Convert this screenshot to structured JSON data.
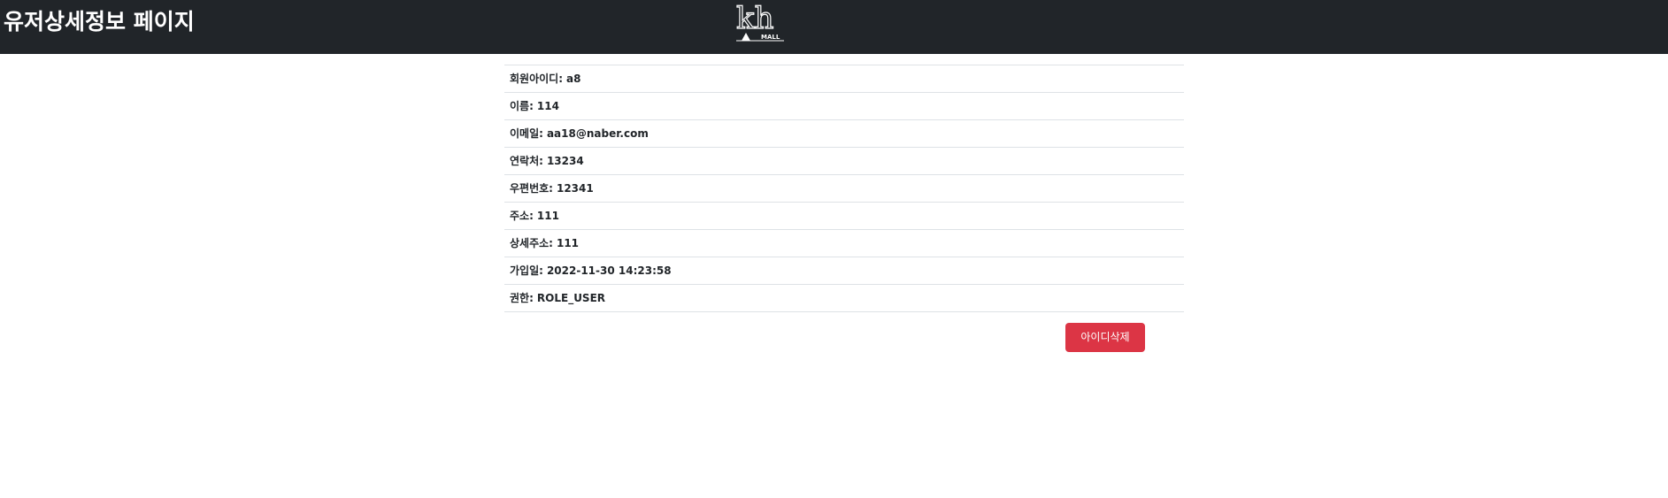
{
  "header": {
    "title": "유저상세정보 페이지",
    "logo": {
      "icon": "kh-mall-logo-icon",
      "letters": "kh",
      "sub_text": "MALL"
    }
  },
  "user_info": [
    {
      "label": "회원아이디",
      "value": "a8"
    },
    {
      "label": "이름",
      "value": "114"
    },
    {
      "label": "이메일",
      "value": "aa18@naber.com"
    },
    {
      "label": "연락처",
      "value": "13234"
    },
    {
      "label": "우편번호",
      "value": "12341"
    },
    {
      "label": "주소",
      "value": "111"
    },
    {
      "label": "상세주소",
      "value": "111"
    },
    {
      "label": "가입일",
      "value": "2022-11-30 14:23:58"
    },
    {
      "label": "권한",
      "value": "ROLE_USER"
    }
  ],
  "actions": {
    "delete_label": "아이디삭제"
  },
  "colors": {
    "navbar": "#212529",
    "danger": "#dc3545",
    "divider": "#dee2e6"
  }
}
